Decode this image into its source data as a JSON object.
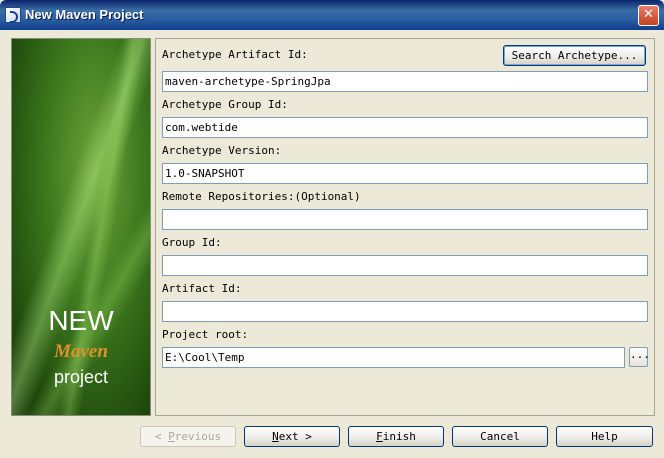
{
  "window": {
    "title": "New Maven Project",
    "close_glyph": "✕"
  },
  "banner": {
    "line1": "NEW",
    "line2": "Maven",
    "line3": "project"
  },
  "form": {
    "search_archetype_label": "Search Archetype...",
    "archetype_artifact_id": {
      "label": "Archetype Artifact Id:",
      "value": "maven-archetype-SpringJpa"
    },
    "archetype_group_id": {
      "label": "Archetype Group Id:",
      "value": "com.webtide"
    },
    "archetype_version": {
      "label": "Archetype Version:",
      "value": "1.0-SNAPSHOT"
    },
    "remote_repositories": {
      "label": "Remote Repositories:(Optional)",
      "value": ""
    },
    "group_id": {
      "label": "Group Id:",
      "value": ""
    },
    "artifact_id": {
      "label": "Artifact Id:",
      "value": ""
    },
    "project_root": {
      "label": "Project root:",
      "value": "E:\\Cool\\Temp",
      "browse_label": "..."
    }
  },
  "footer": {
    "previous": {
      "arrow": "<",
      "mnemonic": "P",
      "rest": "revious"
    },
    "next": {
      "mnemonic": "N",
      "rest": "ext",
      "arrow": ">"
    },
    "finish": {
      "mnemonic": "F",
      "rest": "inish"
    },
    "cancel": {
      "label": "Cancel"
    },
    "help": {
      "label": "Help"
    }
  }
}
